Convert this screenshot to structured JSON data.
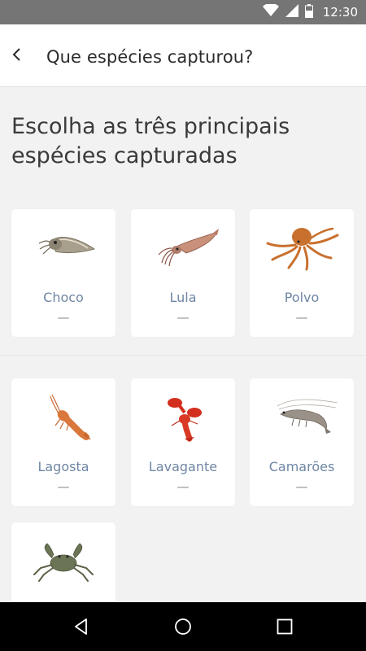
{
  "status_bar": {
    "time": "12:30",
    "icons": [
      "wifi-icon",
      "signal-icon",
      "battery-icon"
    ]
  },
  "app_bar": {
    "back_icon": "chevron-left-icon",
    "title": "Que espécies capturou?"
  },
  "heading": "Escolha as três principais espécies capturadas",
  "species": [
    {
      "name": "Choco",
      "quantity": "—",
      "icon": "cuttlefish-icon"
    },
    {
      "name": "Lula",
      "quantity": "—",
      "icon": "squid-icon"
    },
    {
      "name": "Polvo",
      "quantity": "—",
      "icon": "octopus-icon"
    },
    {
      "name": "Lagosta",
      "quantity": "—",
      "icon": "spiny-lobster-icon"
    },
    {
      "name": "Lavagante",
      "quantity": "—",
      "icon": "lobster-icon"
    },
    {
      "name": "Camarões",
      "quantity": "—",
      "icon": "shrimp-icon"
    },
    {
      "name": "",
      "quantity": "",
      "icon": "crab-icon"
    }
  ],
  "nav_bar": {
    "icons": [
      "back-triangle-icon",
      "home-circle-icon",
      "recents-square-icon"
    ]
  },
  "colors": {
    "status_bar": "#757575",
    "background": "#f2f2f2",
    "card": "#ffffff",
    "species_label": "#6f86a4",
    "nav_bar": "#000000"
  }
}
